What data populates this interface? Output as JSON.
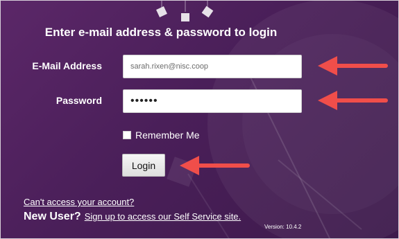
{
  "login": {
    "heading": "Enter e-mail address & password to login",
    "email_label": "E-Mail Address",
    "email_value": "sarah.rixen@nisc.coop",
    "password_label": "Password",
    "password_value": "••••••",
    "remember_label": "Remember Me",
    "login_button": "Login"
  },
  "footer": {
    "cant_access": "Can't access your account?",
    "new_user": "New User?",
    "signup_link": "Sign up to access our Self Service site.",
    "version": "Version: 10.4.2"
  },
  "colors": {
    "background": "#4a1f59",
    "arrow": "#f04e4a",
    "text": "#ffffff"
  }
}
